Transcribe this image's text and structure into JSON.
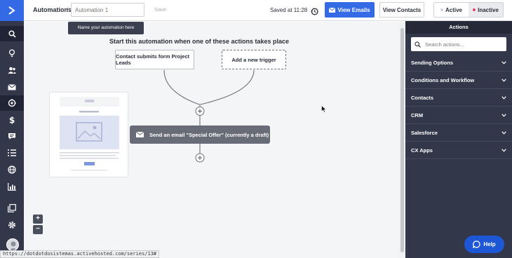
{
  "header": {
    "breadcrumb": "Automations",
    "separator": "/",
    "name_placeholder": "Automation 1",
    "save_label": "Save",
    "saved_at": "Saved at 11:28",
    "view_emails_label": "View Emails",
    "view_contacts_label": "View Contacts",
    "status_toggle": {
      "active_label": "Active",
      "inactive_label": "Inactive",
      "selected": "Inactive"
    }
  },
  "canvas": {
    "tooltip": "Name your automation here",
    "headline": "Start this automation when one of these actions takes place",
    "triggers": [
      {
        "label": "Contact submits form Project Leads"
      },
      {
        "label": "Add a new trigger"
      }
    ],
    "action": {
      "label": "Send an email \"Special Offer\" (currently a draft)",
      "icon": "envelope-icon"
    },
    "zoom_in": "+",
    "zoom_out": "−"
  },
  "panel": {
    "title": "Actions",
    "search_placeholder": "Search actions...",
    "sections": [
      {
        "label": "Sending Options"
      },
      {
        "label": "Conditions and Workflow"
      },
      {
        "label": "Contacts"
      },
      {
        "label": "CRM"
      },
      {
        "label": "Salesforce"
      },
      {
        "label": "CX Apps"
      }
    ]
  },
  "help_label": "Help",
  "status_url": "https://dotdotdosistemas.activehosted.com/series/13#",
  "rail": {
    "icons": [
      "search-icon",
      "lightbulb-icon",
      "contacts-icon",
      "mail-icon",
      "automation-icon",
      "dollar-icon",
      "chat-icon",
      "list-icon",
      "globe-icon",
      "reports-icon",
      "pages-icon",
      "settings-icon"
    ]
  },
  "colors": {
    "accent": "#356ae6",
    "rail": "#32374a",
    "panel": "#32374a",
    "help": "#1e57d6",
    "inactive_dot": "#e2466e"
  }
}
